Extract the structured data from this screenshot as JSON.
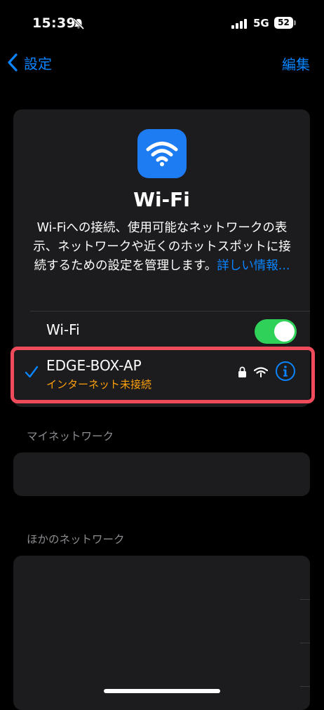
{
  "status_bar": {
    "time": "15:39",
    "network_type": "5G",
    "battery_level": "52",
    "icons": [
      "bell-slash-icon",
      "cellular-signal-icon",
      "battery-icon"
    ]
  },
  "nav": {
    "back_label": "設定",
    "edit_label": "編集"
  },
  "wifi_card": {
    "title": "Wi-Fi",
    "description": "Wi-Fiへの接続、使用可能なネットワークの表示、ネットワークや近くのホットスポットに接続するための設定を管理します。",
    "learn_more": "詳しい情報...",
    "toggle_label": "Wi-Fi",
    "toggle_on": true
  },
  "connected_network": {
    "name": "EDGE-BOX-AP",
    "status": "インターネット未接続",
    "icons": [
      "checkmark-icon",
      "lock-icon",
      "wifi-signal-icon",
      "info-icon"
    ]
  },
  "sections": {
    "my_networks": "マイネットワーク",
    "other_networks": "ほかのネットワーク"
  },
  "colors": {
    "accent": "#0a84ff",
    "toggle_on": "#30d158",
    "warning": "#ff9f0a",
    "highlight": "#ef4b5b",
    "card_bg": "#1c1c1e"
  }
}
